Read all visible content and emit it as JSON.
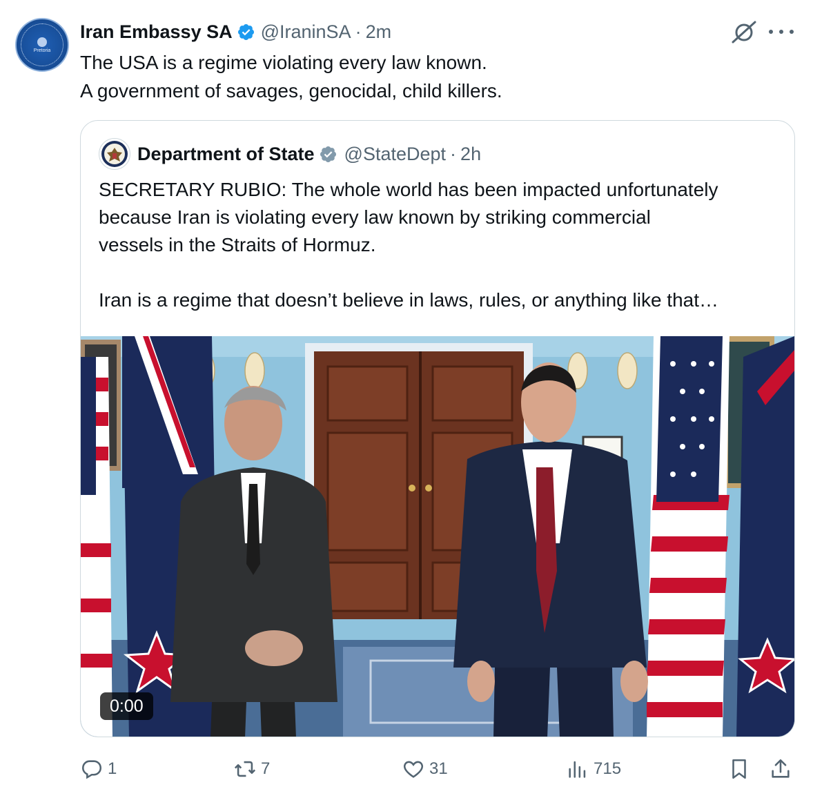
{
  "tweet": {
    "author_name": "Iran Embassy SA",
    "handle": "@IraninSA",
    "separator": "·",
    "time": "2m",
    "avatar_label": "Pretoria",
    "text_lines": [
      "The USA is a regime violating every law known.",
      "A government of savages, genocidal, child killers."
    ]
  },
  "quote": {
    "author_name": "Department of State",
    "handle": "@StateDept",
    "separator": "·",
    "time": "2h",
    "text_lines": [
      "SECRETARY RUBIO: The whole world has been impacted unfortunately",
      "because Iran is violating every law known by striking commercial",
      "vessels in the Straits of Hormuz.",
      "",
      "Iran is a regime that doesn’t believe in laws, rules, or anything like that…"
    ],
    "video_duration": "0:00"
  },
  "actions": {
    "replies": "1",
    "retweets": "7",
    "likes": "31",
    "views": "715"
  },
  "colors": {
    "text": "#0f1419",
    "secondary": "#536471",
    "verified": "#1d9bf0",
    "border": "#cfd9de",
    "avatar_blue": "#1f5fb4"
  },
  "icons": [
    "verified-badge-icon",
    "grok-icon",
    "more-icon",
    "reply-icon",
    "retweet-icon",
    "like-icon",
    "views-icon",
    "bookmark-icon",
    "share-icon",
    "state-seal-icon"
  ]
}
